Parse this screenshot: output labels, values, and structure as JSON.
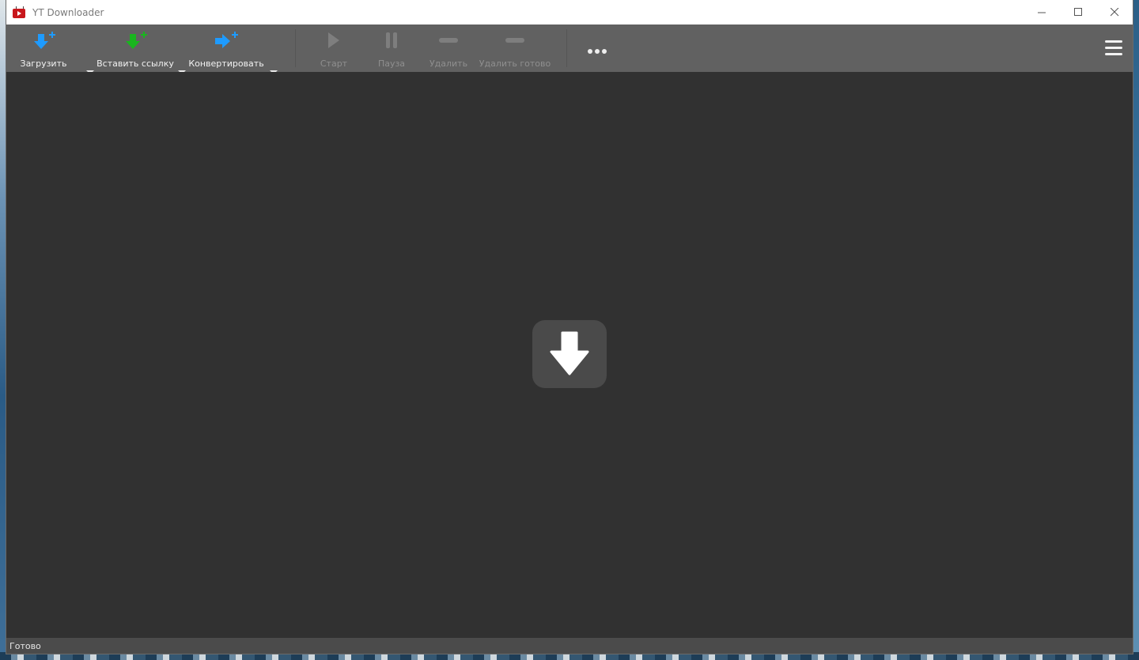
{
  "window": {
    "title": "YT Downloader"
  },
  "toolbar": {
    "download_label": "Загрузить",
    "paste_link_label": "Вставить ссылку",
    "convert_label": "Конвертировать",
    "start_label": "Старт",
    "pause_label": "Пауза",
    "delete_label": "Удалить",
    "delete_done_label": "Удалить готово"
  },
  "status": {
    "text": "Готово"
  },
  "icons": {
    "download": "download-plus-icon",
    "paste": "paste-link-plus-icon",
    "convert": "convert-plus-icon",
    "start": "play-icon",
    "pause": "pause-icon",
    "delete": "minus-icon",
    "delete_done": "minus-icon",
    "more": "more-dots-icon",
    "menu": "hamburger-menu-icon",
    "drop": "download-arrow-icon"
  },
  "colors": {
    "accent_blue": "#1e9bff",
    "accent_green": "#19b51e",
    "toolbar_bg": "#616161",
    "content_bg": "#313131"
  }
}
